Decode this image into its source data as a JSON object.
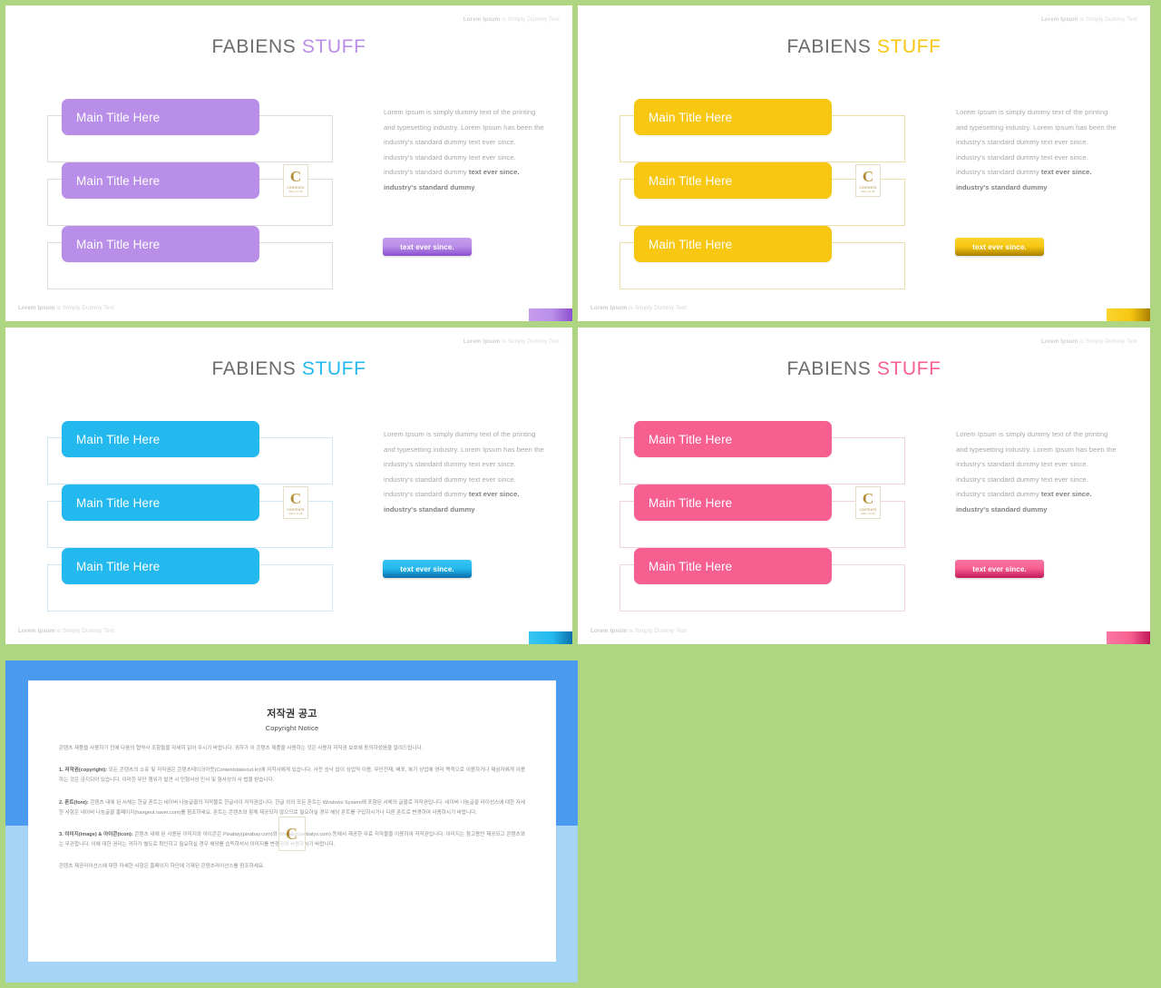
{
  "theme": {
    "page_background": "#aed581",
    "slide_background": "#ffffff",
    "title_gray": "#6b6b6b",
    "body_gray": "#a8a8a8"
  },
  "slides": [
    {
      "id": "slide-purple",
      "accent": "#b88ee8",
      "accent_light": "#c79cee",
      "accent_dark": "#8c4fd0",
      "outline_color": "#dcdcdc",
      "top_note_bold": "Lorem Ipsum",
      "top_note_rest": " is Simply Dummy Text",
      "bottom_note_bold": "Lorem Ipsum",
      "bottom_note_rest": " is Simply Dummy Text",
      "title_main": "FABIENS",
      "title_accent": "STUFF",
      "rows": [
        {
          "label": "Main Title Here"
        },
        {
          "label": "Main Title Here"
        },
        {
          "label": "Main Title Here"
        }
      ],
      "paragraph_regular": "Lorem Ipsum is simply dummy text of the printing and typesetting industry.  Lorem Ipsum has been the industry's standard dummy text ever since. industry's standard dummy text ever since. industry's standard dummy ",
      "paragraph_strong": "text ever since. industry's standard dummy",
      "cta_label": "text ever since.",
      "logo": {
        "letter": "C",
        "line1": "CONTENTS",
        "line2": "MALL  CLUB"
      }
    },
    {
      "id": "slide-yellow",
      "accent": "#f7c712",
      "accent_light": "#fbd42e",
      "accent_dark": "#a87f00",
      "outline_color": "#eadfa8",
      "top_note_bold": "Lorem Ipsum",
      "top_note_rest": " is Simply Dummy Text",
      "bottom_note_bold": "Lorem Ipsum",
      "bottom_note_rest": " is Simply Dummy Text",
      "title_main": "FABIENS",
      "title_accent": "STUFF",
      "rows": [
        {
          "label": "Main Title Here"
        },
        {
          "label": "Main Title Here"
        },
        {
          "label": "Main Title Here"
        }
      ],
      "paragraph_regular": "Lorem Ipsum is simply dummy text of the printing and typesetting industry.  Lorem Ipsum has been the industry's standard dummy text ever since. industry's standard dummy text ever since. industry's standard dummy ",
      "paragraph_strong": "text ever since. industry's standard dummy",
      "cta_label": "text ever since.",
      "logo": {
        "letter": "C",
        "line1": "CONTENTS",
        "line2": "MALL  CLUB"
      }
    },
    {
      "id": "slide-cyan",
      "accent": "#23b8ee",
      "accent_light": "#39c5f2",
      "accent_dark": "#0a6ea8",
      "outline_color": "#cfe8f4",
      "top_note_bold": "Lorem Ipsum",
      "top_note_rest": " is Simply Dummy Text",
      "bottom_note_bold": "Lorem Ipsum",
      "bottom_note_rest": " is Simply Dummy Text",
      "title_main": "FABIENS",
      "title_accent": "STUFF",
      "rows": [
        {
          "label": "Main Title Here"
        },
        {
          "label": "Main Title Here"
        },
        {
          "label": "Main Title Here"
        }
      ],
      "paragraph_regular": "Lorem Ipsum is simply dummy text of the printing and typesetting industry.  Lorem Ipsum has been the industry's standard dummy text ever since. industry's standard dummy text ever since. industry's standard dummy ",
      "paragraph_strong": "text ever since. industry's standard dummy",
      "cta_label": "text ever since.",
      "logo": {
        "letter": "C",
        "line1": "CONTENTS",
        "line2": "MALL  CLUB"
      }
    },
    {
      "id": "slide-pink",
      "accent": "#f75f90",
      "accent_light": "#fa77a3",
      "accent_dark": "#c2185b",
      "outline_color": "#f3d3de",
      "top_note_bold": "Lorem Ipsum",
      "top_note_rest": " is Simply Dummy Text",
      "bottom_note_bold": "Lorem Ipsum",
      "bottom_note_rest": " is Simply Dummy Text",
      "title_main": "FABIENS",
      "title_accent": "STUFF",
      "rows": [
        {
          "label": "Main Title Here"
        },
        {
          "label": "Main Title Here"
        },
        {
          "label": "Main Title Here"
        }
      ],
      "paragraph_regular": "Lorem Ipsum is simply dummy text of the printing and typesetting industry.  Lorem Ipsum has been the industry's standard dummy text ever since. industry's standard dummy text ever since. industry's standard dummy ",
      "paragraph_strong": "text ever since. industry's standard dummy",
      "cta_label": "text ever since.",
      "logo": {
        "letter": "C",
        "line1": "CONTENTS",
        "line2": "MALL  CLUB"
      }
    }
  ],
  "copyright_slide": {
    "id": "slide-copyright",
    "background": "#4a9bf0",
    "band_color": "#a6d4f7",
    "title_ko": "저작권 공고",
    "title_en": "Copyright Notice",
    "intro": "콘텐츠 제품을 사용하기 전에 다음의 협약사 조항들을 자세히 읽어 주시기 바랍니다. 귀하가 이 콘텐츠 제품을 사용하는 것은 사용자 저작권 보호에 동의하셨음을 알려드립니다.",
    "items": [
      {
        "lead": "1. 저작권(copyright):",
        "text": " 모든 콘텐츠의 소유 및 저작권은 콘텐츠테이크아웃(Contentstakeout.kr)에 저작사에게 있습니다. 사전 승낙 없이 상업적 이용, 무단전재, 배포, 복기 상업에 영리 목적으로 이용하거나 제삼자에게 이용하는 것은 금지되어 있습니다. 이러한 무단 행위가 발견 시 민형사상 민사 및 형사상의 사 법을 받습니다."
      },
      {
        "lead": "2. 폰트(font):",
        "text": " 콘텐츠 내에 된 서체는 한글 폰트는 네이버 나눔글꼴의 저작물로 한글사이 저작권입니다. 한글 외의 모든 폰트는 Windows System에 포함된 서체의 글꼴로 저작권입니다. 네이버 나눔글꼴 라이선스에 대한 자세한 사항은 네이버 나눔글꼴 홈페이지(hangeul.naver.com)를 참조하세요. 폰트는 콘텐츠와 함께 제공되지 않으므로 필요하실 경우 해당 폰트를 구입하시거나 다른 폰트로 변경하여 사용하시기 바랍니다."
      },
      {
        "lead": "3. 이미지(image) & 아이콘(icon):",
        "text": " 콘텐츠 내에 된 사용된 이미지와 아이콘은 Pixabay(pixabay.com)와 Webalys(webalys.com) 등에서 제공한 무료 저작물을 이용하여 저작권입니다. 이미지는 참고용만 제공되고 콘텐츠와는 무관합니다. 이에 대한 권리는 귀하가 별도로 확인하고 필요하실 경우 해당를 습득하셔서 이미지를 변경하여 사용하시기 바랍니다."
      }
    ],
    "footer": "콘텐츠 제공라이선스에 대한 자세한 사항은 홈페이지 하단에 기재된 콘텐츠라이선스를 참조하세요.",
    "logo": {
      "letter": "C"
    }
  }
}
